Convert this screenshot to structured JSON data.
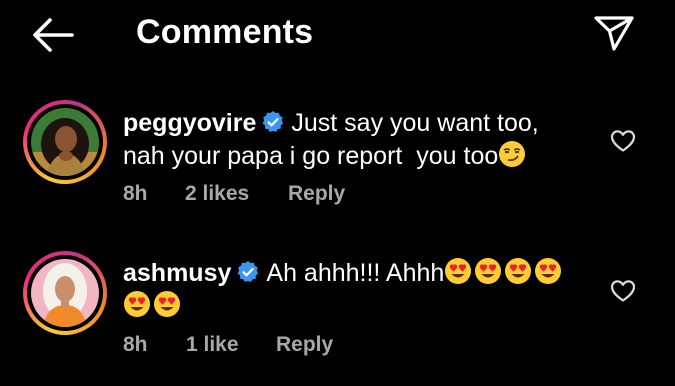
{
  "header": {
    "title": "Comments",
    "back_icon": "arrow-left-icon",
    "share_icon": "paper-plane-icon"
  },
  "colors": {
    "background": "#000000",
    "text": "#ffffff",
    "meta": "#a8a8a8",
    "verified": "#3897f0",
    "story_ring": "#ee2a7b"
  },
  "comments": [
    {
      "username": "peggyovire",
      "verified": true,
      "text_line1": "Just say you want too,",
      "text_line2": "nah your papa i go report  you too",
      "trailing_emoji": "smirk-emoji",
      "time": "8h",
      "likes": "2 likes",
      "reply": "Reply",
      "like_icon": "heart-outline-icon"
    },
    {
      "username": "ashmusy",
      "verified": true,
      "text_line1": "Ah ahhh!!! Ahhh",
      "emoji_line1": [
        "heart-eyes-emoji",
        "heart-eyes-emoji",
        "heart-eyes-emoji",
        "heart-eyes-emoji"
      ],
      "emoji_line2": [
        "heart-eyes-emoji",
        "heart-eyes-emoji"
      ],
      "time": "8h",
      "likes": "1 like",
      "reply": "Reply",
      "like_icon": "heart-outline-icon"
    }
  ]
}
